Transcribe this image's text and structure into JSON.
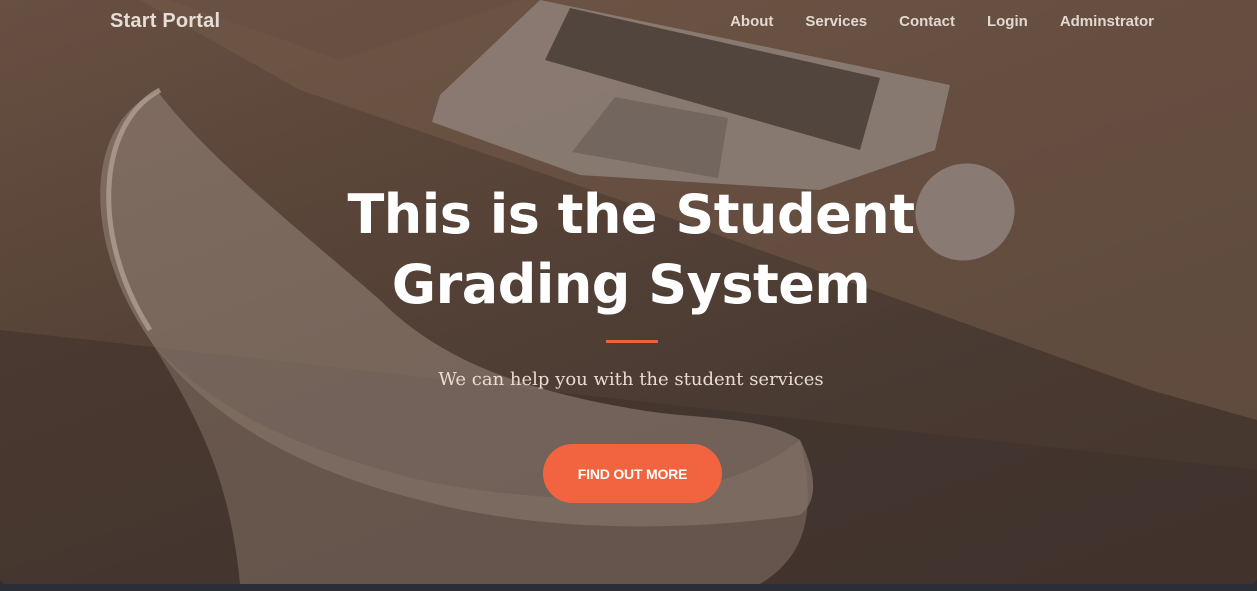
{
  "nav": {
    "brand": "Start Portal",
    "links": [
      "About",
      "Services",
      "Contact",
      "Login",
      "Adminstrator"
    ]
  },
  "hero": {
    "title": "This is the Student Grading System",
    "subtitle": "We can help you with the student services",
    "cta_label": "FIND OUT MORE"
  },
  "colors": {
    "accent": "#f26440",
    "overlay": "#5a463b",
    "page_background": "#2b2e36"
  }
}
